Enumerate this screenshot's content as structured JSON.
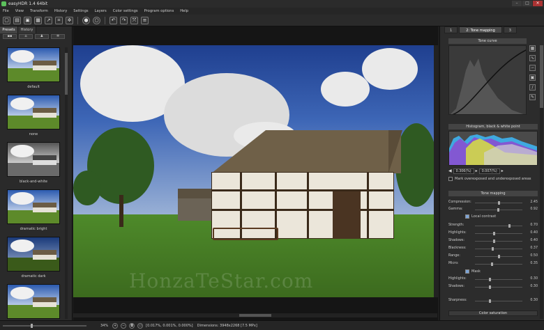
{
  "window": {
    "title": "easyHDR 1.4  64bit",
    "min": "–",
    "max": "□",
    "close": "×"
  },
  "menu": [
    "File",
    "View",
    "Transform",
    "History",
    "Settings",
    "Layers",
    "Color settings",
    "Program options",
    "Help"
  ],
  "toolbar": {
    "icons": [
      "new-file-icon",
      "open-icon",
      "save-icon",
      "save-as-icon",
      "export-icon",
      "crop-icon",
      "settings-icon",
      "record-icon",
      "clear-icon",
      "undo-icon",
      "redo-icon",
      "transform-icon",
      "layers-icon"
    ]
  },
  "left_panel": {
    "tabs": [
      "Presets",
      "History"
    ],
    "presets": [
      {
        "label": "default",
        "style": ""
      },
      {
        "label": "none",
        "style": ""
      },
      {
        "label": "black-and-white",
        "style": "bw"
      },
      {
        "label": "dramatic bright",
        "style": ""
      },
      {
        "label": "dramatic dark",
        "style": "dark"
      },
      {
        "label": "",
        "style": ""
      }
    ]
  },
  "canvas": {
    "watermark": "HonzaTeStar.com"
  },
  "right_panel": {
    "tabs": [
      "1",
      "2: Tone mapping",
      "3"
    ],
    "tone_curve_header": "Tone curve",
    "histogram_header": "Histogram, black & white point",
    "hist_values": {
      "left": "0.306(%)",
      "right": "0.007(%)"
    },
    "mark_label": "Mark overexposed and underexposed areas",
    "tone_mapping_header": "Tone mapping",
    "sliders": [
      {
        "label": "Compression:",
        "value": "2.45",
        "pos": 0.5
      },
      {
        "label": "Gamma:",
        "value": "0.92",
        "pos": 0.48
      },
      {
        "label": "Strength:",
        "value": "0.70",
        "pos": 0.72
      },
      {
        "label": "Highlights:",
        "value": "0.40",
        "pos": 0.4
      },
      {
        "label": "Shadows:",
        "value": "0.40",
        "pos": 0.4
      },
      {
        "label": "Blackness:",
        "value": "0.37",
        "pos": 0.37
      },
      {
        "label": "Range:",
        "value": "0.50",
        "pos": 0.5
      },
      {
        "label": "Micro:",
        "value": "0.35",
        "pos": 0.35
      },
      {
        "label": "Highlights:",
        "value": "0.30",
        "pos": 0.3
      },
      {
        "label": "Shadows:",
        "value": "0.30",
        "pos": 0.3
      },
      {
        "label": "Sharpness:",
        "value": "0.30",
        "pos": 0.3
      }
    ],
    "local_contrast_label": "Local contrast",
    "mask_label": "Mask",
    "color_saturation_label": "Color saturation"
  },
  "status": {
    "zoom": "34%",
    "info": "[0.017%, 0.001%, 0.000%]",
    "dimensions": "Dimensions: 3948x2268 [7.5 MPx]"
  }
}
